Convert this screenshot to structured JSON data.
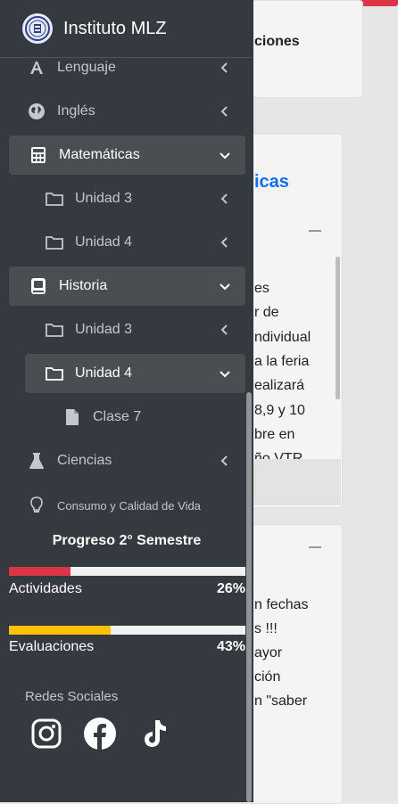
{
  "app": {
    "brand": "Instituto MLZ"
  },
  "background": {
    "card1_text": "ciones",
    "card2_title": "icas",
    "card2_lines": [
      "es",
      "r de",
      "ndividual",
      "a la feria",
      "ealizará",
      "8,9 y 10",
      "bre en",
      "ño VTR"
    ],
    "card3_lines": [
      "n fechas",
      "s !!!",
      "ayor",
      "ción",
      "n \"saber"
    ]
  },
  "nav": {
    "items": [
      {
        "label": "Lenguaje",
        "icon": "font-icon"
      },
      {
        "label": "Inglés",
        "icon": "globe-icon"
      },
      {
        "label": "Matemáticas",
        "icon": "calculator-icon"
      },
      {
        "label": "Unidad 3",
        "icon": "folder-icon"
      },
      {
        "label": "Unidad 4",
        "icon": "folder-icon"
      },
      {
        "label": "Historia",
        "icon": "book-icon"
      },
      {
        "label": "Unidad 3",
        "icon": "folder-icon"
      },
      {
        "label": "Unidad 4",
        "icon": "folder-icon"
      },
      {
        "label": "Clase 7",
        "icon": "file-icon"
      },
      {
        "label": "Ciencias",
        "icon": "flask-icon"
      },
      {
        "label": "Consumo y Calidad de Vida",
        "icon": "lightbulb-icon"
      }
    ]
  },
  "progress": {
    "title": "Progreso 2° Semestre",
    "activities": {
      "label": "Actividades",
      "value": "26%",
      "fraction": 0.26,
      "color": "#dc3545"
    },
    "evaluations": {
      "label": "Evaluaciones",
      "value": "43%",
      "fraction": 0.43,
      "color": "#ffc107"
    }
  },
  "social": {
    "title": "Redes Sociales",
    "icons": [
      "instagram-icon",
      "facebook-icon",
      "tiktok-icon"
    ]
  },
  "colors": {
    "sidebar": "#343a40",
    "active": "#494e53",
    "brand_text": "#ffffff"
  }
}
